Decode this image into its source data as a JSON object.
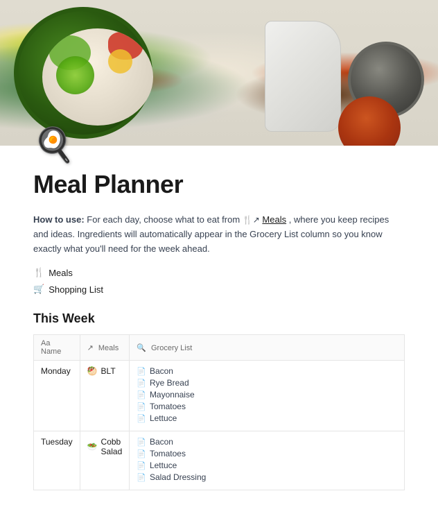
{
  "hero": {
    "alt": "Food bowl hero image"
  },
  "page": {
    "icon": "🍳",
    "title": "Meal Planner",
    "how_to_label": "How to use:",
    "how_to_text1": " For each day, choose what to eat from ",
    "meals_link": "Meals",
    "how_to_text2": ", where you keep recipes and ideas. Ingredients will automatically appear in the Grocery List column so you know exactly what you'll need for the week ahead.",
    "link1_icon": "🍴",
    "link1_label": "Meals",
    "link2_icon": "🛒",
    "link2_label": "Shopping List"
  },
  "week": {
    "title": "This Week",
    "table": {
      "headers": [
        {
          "icon": "Aa",
          "label": "Name"
        },
        {
          "icon": "↗",
          "label": "Meals"
        },
        {
          "icon": "🔍",
          "label": "Grocery List"
        }
      ],
      "rows": [
        {
          "day": "Monday",
          "meal_icon": "🥙",
          "meal": "BLT",
          "grocery": [
            {
              "icon": "📄",
              "text": "Bacon"
            },
            {
              "icon": "📄",
              "text": "Rye Bread"
            },
            {
              "icon": "📄",
              "text": "Mayonnaise"
            },
            {
              "icon": "📄",
              "text": "Tomatoes"
            },
            {
              "icon": "📄",
              "text": "Lettuce"
            }
          ]
        },
        {
          "day": "Tuesday",
          "meal_icon": "🥗",
          "meal": "Cobb Salad",
          "grocery": [
            {
              "icon": "📄",
              "text": "Bacon"
            },
            {
              "icon": "📄",
              "text": "Tomatoes"
            },
            {
              "icon": "📄",
              "text": "Lettuce"
            },
            {
              "icon": "📄",
              "text": "Salad Dressing"
            }
          ]
        }
      ]
    }
  }
}
